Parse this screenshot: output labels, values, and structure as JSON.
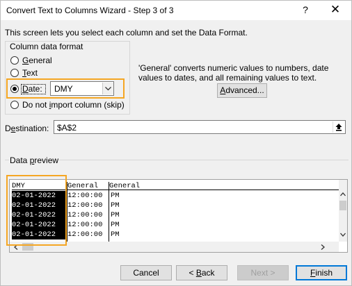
{
  "window": {
    "title": "Convert Text to Columns Wizard - Step 3 of 3",
    "help_glyph": "?",
    "close_glyph": "✕"
  },
  "description": "This screen lets you select each column and set the Data Format.",
  "column_format": {
    "legend": "Column data format",
    "options": [
      {
        "hot": "G",
        "rest": "eneral",
        "checked": false
      },
      {
        "hot": "T",
        "rest": "ext",
        "checked": false
      },
      {
        "hot": "D",
        "rest": "ate:",
        "checked": true
      },
      {
        "pre": "Do not ",
        "hot": "i",
        "rest": "mport column (skip)",
        "checked": false
      }
    ],
    "date_value": "DMY"
  },
  "info_text": "'General' converts numeric values to numbers, date values to dates, and all remaining values to text.",
  "advanced_button": {
    "hot": "A",
    "rest": "dvanced..."
  },
  "destination": {
    "pre": "D",
    "hot": "e",
    "rest": "stination:",
    "value": "$A$2"
  },
  "preview": {
    "legend_pre": "Data ",
    "legend_hot": "p",
    "legend_rest": "review",
    "headers": [
      "DMY",
      "General",
      "General"
    ],
    "rows": [
      [
        "02-01-2022",
        "12:00:00",
        "PM"
      ],
      [
        "02-01-2022",
        "12:00:00",
        "PM"
      ],
      [
        "02-01-2022",
        "12:00:00",
        "PM"
      ],
      [
        "02-01-2022",
        "12:00:00",
        "PM"
      ],
      [
        "02-01-2022",
        "12:00:00",
        "PM"
      ]
    ]
  },
  "buttons": {
    "cancel": "Cancel",
    "back_pre": "< ",
    "back_hot": "B",
    "back_rest": "ack",
    "next_pre": "Next >",
    "finish_hot": "F",
    "finish_rest": "inish"
  },
  "colors": {
    "highlight": "#f5a623",
    "focus": "#0078d7"
  }
}
